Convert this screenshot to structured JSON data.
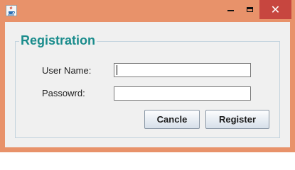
{
  "window": {
    "minimize_glyph": "—",
    "maximize_glyph": "□",
    "close_glyph": "✕",
    "icon": "java-cup-icon"
  },
  "form": {
    "title": "Registration",
    "user_name_label": "User Name:",
    "password_label": "Passowrd:",
    "user_name_value": "",
    "password_value": ""
  },
  "buttons": {
    "cancel_label": "Cancle",
    "register_label": "Register"
  },
  "colors": {
    "title_bar": "#e8926a",
    "close_button": "#c7463f",
    "group_title": "#1a8c8c",
    "client_bg": "#f0f0f0"
  }
}
